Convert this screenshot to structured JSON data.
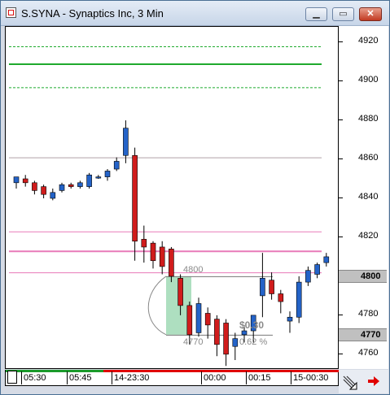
{
  "window": {
    "title": "S.SYNA - Synaptics Inc, 3 Min",
    "buttons": {
      "minimize": "▁",
      "restore": "▭",
      "close": "✕"
    }
  },
  "price_axis": {
    "ticks": [
      "4920",
      "4900",
      "4880",
      "4860",
      "4840",
      "4820",
      "4800",
      "4780",
      "4760"
    ],
    "highlighted": [
      {
        "label": "4800",
        "color": "#c0c0c0"
      },
      {
        "label": "4770",
        "color": "#c0c0c0"
      }
    ]
  },
  "chart_annotations": {
    "level_label_top": "4800",
    "level_label_bottom": "4770",
    "move_value": "$0.30",
    "move_percent": "0.62 %"
  },
  "time_axis": {
    "labels": [
      "05:30",
      "05:45",
      "14-23:30",
      "00:00",
      "00:15",
      "15-00:30"
    ]
  },
  "colors": {
    "up_candle": "#2463c8",
    "down_candle": "#d01c1c",
    "green_line": "#1faa2e",
    "pink_line": "#e87ab8",
    "grey_line": "#b0a0a8",
    "time_red": "#e00000",
    "time_green": "#1a9a2a"
  },
  "chart_data": {
    "type": "candlestick",
    "title": "S.SYNA - Synaptics Inc, 3 Min",
    "ylim": [
      4752,
      4928
    ],
    "yticks": [
      4920,
      4900,
      4880,
      4860,
      4840,
      4820,
      4800,
      4780,
      4760
    ],
    "horizontal_levels": [
      {
        "value": 4918,
        "style": "dashed",
        "color": "green"
      },
      {
        "value": 4909,
        "style": "solid",
        "color": "green"
      },
      {
        "value": 4897,
        "style": "dashed",
        "color": "green"
      },
      {
        "value": 4861,
        "style": "solid-thin",
        "color": "grey"
      },
      {
        "value": 4823,
        "style": "solid-thin",
        "color": "pink"
      },
      {
        "value": 4813,
        "style": "solid",
        "color": "pink"
      },
      {
        "value": 4802,
        "style": "solid-thin",
        "color": "pink"
      }
    ],
    "candles": [
      {
        "o": 4848,
        "h": 4850,
        "l": 4845,
        "c": 4851
      },
      {
        "o": 4850,
        "h": 4852,
        "l": 4846,
        "c": 4848
      },
      {
        "o": 4848,
        "h": 4849,
        "l": 4842,
        "c": 4844
      },
      {
        "o": 4846,
        "h": 4847,
        "l": 4840,
        "c": 4842
      },
      {
        "o": 4840,
        "h": 4845,
        "l": 4839,
        "c": 4843
      },
      {
        "o": 4844,
        "h": 4848,
        "l": 4843,
        "c": 4847
      },
      {
        "o": 4847,
        "h": 4848,
        "l": 4845,
        "c": 4846
      },
      {
        "o": 4846,
        "h": 4849,
        "l": 4845,
        "c": 4848
      },
      {
        "o": 4846,
        "h": 4853,
        "l": 4845,
        "c": 4852
      },
      {
        "o": 4851,
        "h": 4852,
        "l": 4850,
        "c": 4851
      },
      {
        "o": 4851,
        "h": 4855,
        "l": 4849,
        "c": 4854
      },
      {
        "o": 4855,
        "h": 4861,
        "l": 4854,
        "c": 4859
      },
      {
        "o": 4862,
        "h": 4880,
        "l": 4858,
        "c": 4876
      },
      {
        "o": 4862,
        "h": 4866,
        "l": 4808,
        "c": 4818
      },
      {
        "o": 4819,
        "h": 4826,
        "l": 4807,
        "c": 4815
      },
      {
        "o": 4817,
        "h": 4818,
        "l": 4804,
        "c": 4808
      },
      {
        "o": 4815,
        "h": 4818,
        "l": 4801,
        "c": 4805
      },
      {
        "o": 4814,
        "h": 4815,
        "l": 4797,
        "c": 4800
      },
      {
        "o": 4799,
        "h": 4801,
        "l": 4780,
        "c": 4785
      },
      {
        "o": 4785,
        "h": 4787,
        "l": 4765,
        "c": 4770
      },
      {
        "o": 4771,
        "h": 4789,
        "l": 4769,
        "c": 4786
      },
      {
        "o": 4781,
        "h": 4784,
        "l": 4768,
        "c": 4775
      },
      {
        "o": 4778,
        "h": 4780,
        "l": 4759,
        "c": 4765
      },
      {
        "o": 4776,
        "h": 4778,
        "l": 4754,
        "c": 4760
      },
      {
        "o": 4764,
        "h": 4771,
        "l": 4757,
        "c": 4768
      },
      {
        "o": 4770,
        "h": 4775,
        "l": 4766,
        "c": 4772
      },
      {
        "o": 4772,
        "h": 4778,
        "l": 4766,
        "c": 4780
      },
      {
        "o": 4790,
        "h": 4812,
        "l": 4779,
        "c": 4799
      },
      {
        "o": 4798,
        "h": 4802,
        "l": 4788,
        "c": 4791
      },
      {
        "o": 4791,
        "h": 4793,
        "l": 4781,
        "c": 4787
      },
      {
        "o": 4777,
        "h": 4782,
        "l": 4771,
        "c": 4779
      },
      {
        "o": 4779,
        "h": 4800,
        "l": 4776,
        "c": 4797
      },
      {
        "o": 4797,
        "h": 4805,
        "l": 4795,
        "c": 4803
      },
      {
        "o": 4801,
        "h": 4807,
        "l": 4799,
        "c": 4806
      },
      {
        "o": 4807,
        "h": 4812,
        "l": 4805,
        "c": 4810
      }
    ]
  }
}
